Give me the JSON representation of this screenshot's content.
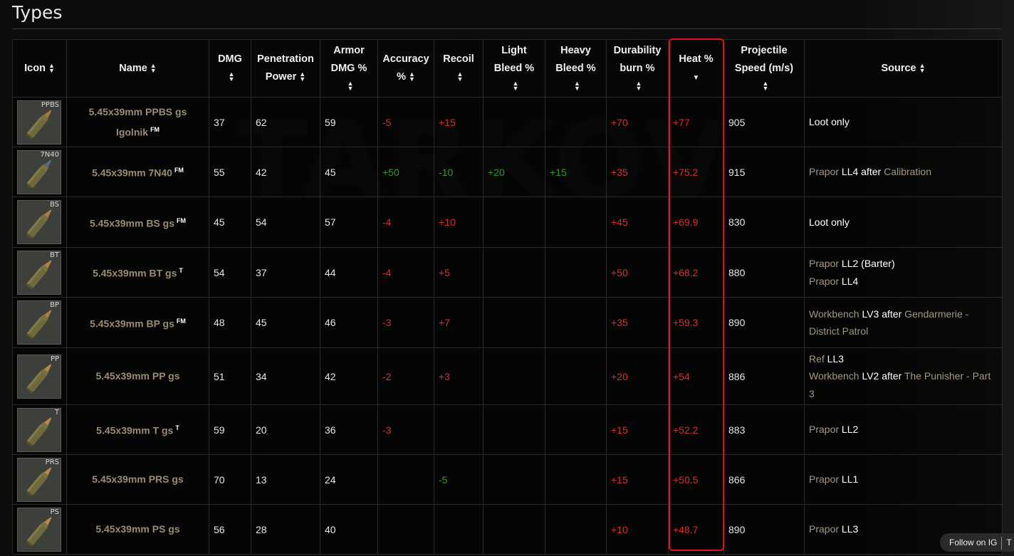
{
  "page": {
    "title": "Types"
  },
  "watermark": "TARKOV",
  "follow": {
    "label": "Follow on IG",
    "next": "T"
  },
  "table": {
    "headers": {
      "icon": "Icon",
      "name": "Name",
      "dmg": "DMG",
      "pen": "Penetration Power",
      "armor": "Armor DMG %",
      "accuracy": "Accuracy %",
      "recoil": "Recoil",
      "light_bleed": "Light Bleed %",
      "heavy_bleed": "Heavy Bleed %",
      "durability": "Durability burn %",
      "heat": "Heat %",
      "speed": "Projectile Speed (m/s)",
      "source": "Source"
    },
    "rows": [
      {
        "tag": "PPBS",
        "icon": "ammo-icon",
        "color": "#a57a45",
        "name": "5.45x39mm PPBS gs Igolnik",
        "badge": "FM",
        "dmg": "37",
        "pen": "62",
        "armor": "59",
        "accuracy": "-5",
        "recoil": "+15",
        "light_bleed": "",
        "heavy_bleed": "",
        "durability": "+70",
        "heat": "+77",
        "speed": "905",
        "source": [
          {
            "text": "Loot only",
            "style": "strong"
          }
        ]
      },
      {
        "tag": "7N40",
        "icon": "ammo-icon",
        "color": "#5a6a7a",
        "name": "5.45x39mm 7N40",
        "badge": "FM",
        "dmg": "55",
        "pen": "42",
        "armor": "45",
        "accuracy": "+50",
        "recoil": "-10",
        "light_bleed": "+20",
        "heavy_bleed": "+15",
        "durability": "+35",
        "heat": "+75.2",
        "speed": "915",
        "source": [
          {
            "text": "Prapor",
            "style": "muted"
          },
          {
            "text": " LL4 after ",
            "style": "strong"
          },
          {
            "text": "Calibration",
            "style": "muted"
          }
        ]
      },
      {
        "tag": "BS",
        "icon": "ammo-icon",
        "color": "#b07a45",
        "name": "5.45x39mm BS gs",
        "badge": "FM",
        "dmg": "45",
        "pen": "54",
        "armor": "57",
        "accuracy": "-4",
        "recoil": "+10",
        "light_bleed": "",
        "heavy_bleed": "",
        "durability": "+45",
        "heat": "+69.9",
        "speed": "830",
        "source": [
          {
            "text": "Loot only",
            "style": "strong"
          }
        ]
      },
      {
        "tag": "BT",
        "icon": "ammo-icon",
        "color": "#c07a40",
        "name": "5.45x39mm BT gs",
        "badge": "T",
        "dmg": "54",
        "pen": "37",
        "armor": "44",
        "accuracy": "-4",
        "recoil": "+5",
        "light_bleed": "",
        "heavy_bleed": "",
        "durability": "+50",
        "heat": "+68.2",
        "speed": "880",
        "source": [
          {
            "text": "Prapor",
            "style": "muted"
          },
          {
            "text": " LL2 (Barter)",
            "style": "strong"
          },
          {
            "text": "\n"
          },
          {
            "text": "Prapor",
            "style": "muted"
          },
          {
            "text": " LL4",
            "style": "strong"
          }
        ]
      },
      {
        "tag": "BP",
        "icon": "ammo-icon",
        "color": "#b07a45",
        "name": "5.45x39mm BP gs",
        "badge": "FM",
        "dmg": "48",
        "pen": "45",
        "armor": "46",
        "accuracy": "-3",
        "recoil": "+7",
        "light_bleed": "",
        "heavy_bleed": "",
        "durability": "+35",
        "heat": "+59.3",
        "speed": "890",
        "source": [
          {
            "text": "Workbench",
            "style": "muted"
          },
          {
            "text": " LV3 after ",
            "style": "strong"
          },
          {
            "text": "Gendarmerie - District Patrol",
            "style": "muted"
          }
        ]
      },
      {
        "tag": "PP",
        "icon": "ammo-icon",
        "color": "#b8874a",
        "name": "5.45x39mm PP gs",
        "badge": "",
        "dmg": "51",
        "pen": "34",
        "armor": "42",
        "accuracy": "-2",
        "recoil": "+3",
        "light_bleed": "",
        "heavy_bleed": "",
        "durability": "+20",
        "heat": "+54",
        "speed": "886",
        "source": [
          {
            "text": "Ref",
            "style": "muted"
          },
          {
            "text": " LL3",
            "style": "strong"
          },
          {
            "text": "\n"
          },
          {
            "text": "Workbench",
            "style": "muted"
          },
          {
            "text": " LV2 after ",
            "style": "strong"
          },
          {
            "text": "The Punisher - Part 3",
            "style": "muted"
          }
        ]
      },
      {
        "tag": "T",
        "icon": "ammo-icon",
        "color": "#b8874a",
        "name": "5.45x39mm T gs",
        "badge": "T",
        "dmg": "59",
        "pen": "20",
        "armor": "36",
        "accuracy": "-3",
        "recoil": "",
        "light_bleed": "",
        "heavy_bleed": "",
        "durability": "+15",
        "heat": "+52.2",
        "speed": "883",
        "source": [
          {
            "text": "Prapor",
            "style": "muted"
          },
          {
            "text": " LL2",
            "style": "strong"
          }
        ]
      },
      {
        "tag": "PRS",
        "icon": "ammo-icon",
        "color": "#b8874a",
        "name": "5.45x39mm PRS gs",
        "badge": "",
        "dmg": "70",
        "pen": "13",
        "armor": "24",
        "accuracy": "",
        "recoil": "-5",
        "light_bleed": "",
        "heavy_bleed": "",
        "durability": "+15",
        "heat": "+50.5",
        "speed": "866",
        "source": [
          {
            "text": "Prapor",
            "style": "muted"
          },
          {
            "text": " LL1",
            "style": "strong"
          }
        ]
      },
      {
        "tag": "PS",
        "icon": "ammo-icon",
        "color": "#b8874a",
        "name": "5.45x39mm PS gs",
        "badge": "",
        "dmg": "56",
        "pen": "28",
        "armor": "40",
        "accuracy": "",
        "recoil": "",
        "light_bleed": "",
        "heavy_bleed": "",
        "durability": "+10",
        "heat": "+48.7",
        "speed": "890",
        "source": [
          {
            "text": "Prapor",
            "style": "muted"
          },
          {
            "text": " LL3",
            "style": "strong"
          }
        ]
      }
    ]
  },
  "colors": {
    "negative": "#d62f2f",
    "positive_good": "#2e9a2e",
    "highlight": "#e3101c"
  }
}
